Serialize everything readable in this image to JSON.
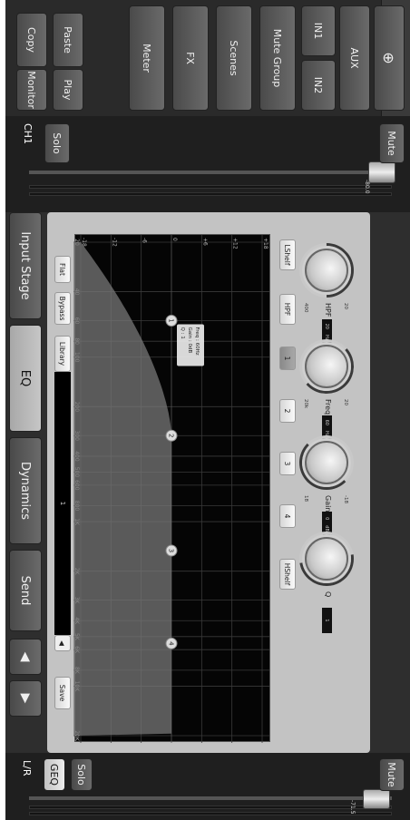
{
  "left_panel": {
    "copy": "Copy",
    "paste": "Paste",
    "monitor": "Monitor",
    "play": "Play",
    "menu": [
      {
        "key": "meter",
        "label": "Meter"
      },
      {
        "key": "fx",
        "label": "FX"
      },
      {
        "key": "scenes",
        "label": "Scenes"
      },
      {
        "key": "mute-group",
        "label": "Mute Group"
      }
    ],
    "in1": "IN1",
    "in2": "IN2",
    "aux": "AUX"
  },
  "channel_strip": {
    "name": "CH1",
    "solo": "Solo",
    "mute": "Mute",
    "fader_value": "-80.0"
  },
  "master_strip": {
    "name": "L/R",
    "geq": "GEQ",
    "solo": "Solo",
    "mute": "Mute",
    "fader_value": "-71.5"
  },
  "tabs": {
    "input_stage": "Input Stage",
    "eq": "EQ",
    "dynamics": "Dynamics",
    "send": "Send",
    "active": "EQ"
  },
  "eq": {
    "flat": "Flat",
    "bypass": "Bypass",
    "library": "Library",
    "preset": "1",
    "save": "Save",
    "gain_ticks": [
      "+18",
      "+12",
      "+6",
      "0",
      "-6",
      "-12",
      "-18"
    ],
    "freq_ticks": [
      "20",
      "40",
      "60",
      "80",
      "100",
      "200",
      "300",
      "400",
      "500",
      "600",
      "800",
      "1K",
      "2K",
      "3K",
      "4K",
      "5K",
      "6K",
      "8K",
      "10K",
      "20K"
    ],
    "bands": [
      {
        "id": "1",
        "freq_hz": 60,
        "gain_db": 0
      },
      {
        "id": "2",
        "freq_hz": 300,
        "gain_db": 0
      },
      {
        "id": "3",
        "freq_hz": 1500,
        "gain_db": 0
      },
      {
        "id": "4",
        "freq_hz": 5500,
        "gain_db": 0
      }
    ],
    "tooltip": {
      "freq": "Freq : 60Hz",
      "gain": "Gain : 0dB",
      "q": "Q      : 1"
    },
    "band_buttons": [
      "LShelf",
      "HPF",
      "1",
      "2",
      "3",
      "4",
      "HShelf"
    ],
    "selected_band": "1",
    "knobs": [
      {
        "key": "hpf",
        "label": "HPF",
        "value": "20",
        "unit": "Hz",
        "min": "20",
        "max": "400",
        "level": 0
      },
      {
        "key": "freq",
        "label": "Freq",
        "value": "60",
        "unit": "Hz",
        "min": "20",
        "max": "20k",
        "level": 0.18
      },
      {
        "key": "gain",
        "label": "Gain",
        "value": "0",
        "unit": "dB",
        "min": "-18",
        "max": "18",
        "level": 0.5
      },
      {
        "key": "q",
        "label": "Q",
        "value": "1",
        "unit": "",
        "min": "",
        "max": "",
        "level": 0.3
      }
    ]
  }
}
